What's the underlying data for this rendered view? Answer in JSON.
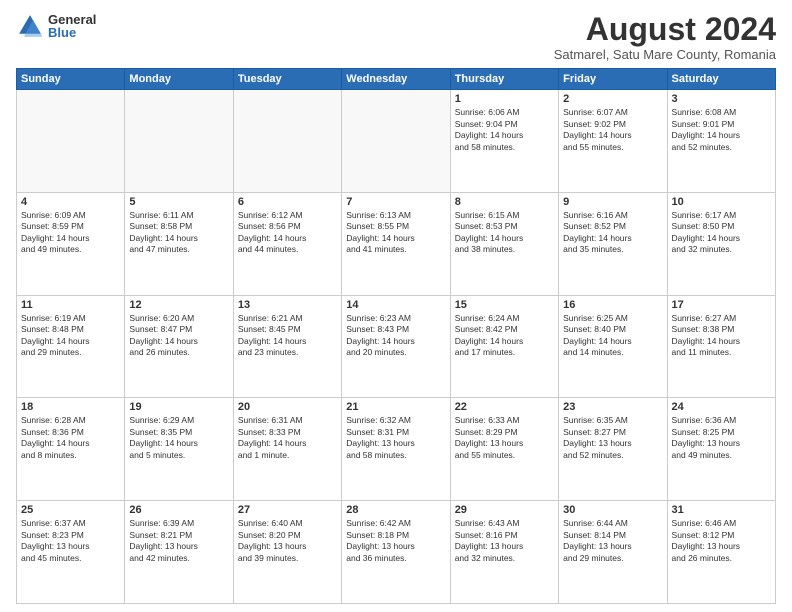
{
  "logo": {
    "general": "General",
    "blue": "Blue"
  },
  "title": "August 2024",
  "subtitle": "Satmarel, Satu Mare County, Romania",
  "days_of_week": [
    "Sunday",
    "Monday",
    "Tuesday",
    "Wednesday",
    "Thursday",
    "Friday",
    "Saturday"
  ],
  "weeks": [
    [
      {
        "day": "",
        "info": ""
      },
      {
        "day": "",
        "info": ""
      },
      {
        "day": "",
        "info": ""
      },
      {
        "day": "",
        "info": ""
      },
      {
        "day": "1",
        "info": "Sunrise: 6:06 AM\nSunset: 9:04 PM\nDaylight: 14 hours\nand 58 minutes."
      },
      {
        "day": "2",
        "info": "Sunrise: 6:07 AM\nSunset: 9:02 PM\nDaylight: 14 hours\nand 55 minutes."
      },
      {
        "day": "3",
        "info": "Sunrise: 6:08 AM\nSunset: 9:01 PM\nDaylight: 14 hours\nand 52 minutes."
      }
    ],
    [
      {
        "day": "4",
        "info": "Sunrise: 6:09 AM\nSunset: 8:59 PM\nDaylight: 14 hours\nand 49 minutes."
      },
      {
        "day": "5",
        "info": "Sunrise: 6:11 AM\nSunset: 8:58 PM\nDaylight: 14 hours\nand 47 minutes."
      },
      {
        "day": "6",
        "info": "Sunrise: 6:12 AM\nSunset: 8:56 PM\nDaylight: 14 hours\nand 44 minutes."
      },
      {
        "day": "7",
        "info": "Sunrise: 6:13 AM\nSunset: 8:55 PM\nDaylight: 14 hours\nand 41 minutes."
      },
      {
        "day": "8",
        "info": "Sunrise: 6:15 AM\nSunset: 8:53 PM\nDaylight: 14 hours\nand 38 minutes."
      },
      {
        "day": "9",
        "info": "Sunrise: 6:16 AM\nSunset: 8:52 PM\nDaylight: 14 hours\nand 35 minutes."
      },
      {
        "day": "10",
        "info": "Sunrise: 6:17 AM\nSunset: 8:50 PM\nDaylight: 14 hours\nand 32 minutes."
      }
    ],
    [
      {
        "day": "11",
        "info": "Sunrise: 6:19 AM\nSunset: 8:48 PM\nDaylight: 14 hours\nand 29 minutes."
      },
      {
        "day": "12",
        "info": "Sunrise: 6:20 AM\nSunset: 8:47 PM\nDaylight: 14 hours\nand 26 minutes."
      },
      {
        "day": "13",
        "info": "Sunrise: 6:21 AM\nSunset: 8:45 PM\nDaylight: 14 hours\nand 23 minutes."
      },
      {
        "day": "14",
        "info": "Sunrise: 6:23 AM\nSunset: 8:43 PM\nDaylight: 14 hours\nand 20 minutes."
      },
      {
        "day": "15",
        "info": "Sunrise: 6:24 AM\nSunset: 8:42 PM\nDaylight: 14 hours\nand 17 minutes."
      },
      {
        "day": "16",
        "info": "Sunrise: 6:25 AM\nSunset: 8:40 PM\nDaylight: 14 hours\nand 14 minutes."
      },
      {
        "day": "17",
        "info": "Sunrise: 6:27 AM\nSunset: 8:38 PM\nDaylight: 14 hours\nand 11 minutes."
      }
    ],
    [
      {
        "day": "18",
        "info": "Sunrise: 6:28 AM\nSunset: 8:36 PM\nDaylight: 14 hours\nand 8 minutes."
      },
      {
        "day": "19",
        "info": "Sunrise: 6:29 AM\nSunset: 8:35 PM\nDaylight: 14 hours\nand 5 minutes."
      },
      {
        "day": "20",
        "info": "Sunrise: 6:31 AM\nSunset: 8:33 PM\nDaylight: 14 hours\nand 1 minute."
      },
      {
        "day": "21",
        "info": "Sunrise: 6:32 AM\nSunset: 8:31 PM\nDaylight: 13 hours\nand 58 minutes."
      },
      {
        "day": "22",
        "info": "Sunrise: 6:33 AM\nSunset: 8:29 PM\nDaylight: 13 hours\nand 55 minutes."
      },
      {
        "day": "23",
        "info": "Sunrise: 6:35 AM\nSunset: 8:27 PM\nDaylight: 13 hours\nand 52 minutes."
      },
      {
        "day": "24",
        "info": "Sunrise: 6:36 AM\nSunset: 8:25 PM\nDaylight: 13 hours\nand 49 minutes."
      }
    ],
    [
      {
        "day": "25",
        "info": "Sunrise: 6:37 AM\nSunset: 8:23 PM\nDaylight: 13 hours\nand 45 minutes."
      },
      {
        "day": "26",
        "info": "Sunrise: 6:39 AM\nSunset: 8:21 PM\nDaylight: 13 hours\nand 42 minutes."
      },
      {
        "day": "27",
        "info": "Sunrise: 6:40 AM\nSunset: 8:20 PM\nDaylight: 13 hours\nand 39 minutes."
      },
      {
        "day": "28",
        "info": "Sunrise: 6:42 AM\nSunset: 8:18 PM\nDaylight: 13 hours\nand 36 minutes."
      },
      {
        "day": "29",
        "info": "Sunrise: 6:43 AM\nSunset: 8:16 PM\nDaylight: 13 hours\nand 32 minutes."
      },
      {
        "day": "30",
        "info": "Sunrise: 6:44 AM\nSunset: 8:14 PM\nDaylight: 13 hours\nand 29 minutes."
      },
      {
        "day": "31",
        "info": "Sunrise: 6:46 AM\nSunset: 8:12 PM\nDaylight: 13 hours\nand 26 minutes."
      }
    ]
  ]
}
